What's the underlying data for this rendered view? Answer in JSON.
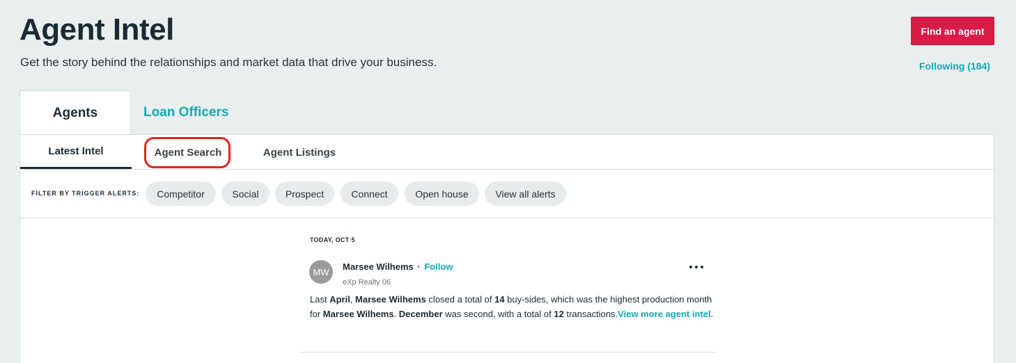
{
  "header": {
    "title": "Agent Intel",
    "subtitle": "Get the story behind the relationships and market data that drive your business.",
    "find_agent_label": "Find an agent",
    "following_label": "Following (184)"
  },
  "main_tabs": [
    {
      "label": "Agents",
      "active": true
    },
    {
      "label": "Loan Officers",
      "active": false
    }
  ],
  "sub_tabs": [
    {
      "label": "Latest Intel",
      "active": true
    },
    {
      "label": "Agent Search",
      "active": false,
      "highlighted": true
    },
    {
      "label": "Agent Listings",
      "active": false
    }
  ],
  "filters": {
    "label": "FILTER BY TRIGGER ALERTS:",
    "chips": [
      "Competitor",
      "Social",
      "Prospect",
      "Connect",
      "Open house",
      "View all alerts"
    ]
  },
  "feed": {
    "date": "TODAY, OCT 5",
    "item": {
      "avatar_initials": "MW",
      "agent_name": "Marsee Wilhems",
      "separator": "·",
      "follow_label": "Follow",
      "brokerage": "eXp Realty 06",
      "text_parts": {
        "p1": "Last ",
        "b1": "April",
        "p2": ", ",
        "b2": "Marsee Wilhems",
        "p3": " closed a total of ",
        "b3": "14",
        "p4": " buy-sides, which was the highest production month for ",
        "b4": "Marsee Wilhems",
        "p5": ". ",
        "b5": "December",
        "p6": " was second, with a total of ",
        "b6": "12",
        "p7": " transactions.",
        "link": "View more agent intel."
      }
    }
  },
  "colors": {
    "accent": "#16a9b7",
    "primary_button": "#d81b47",
    "highlight_ring": "#e5231f",
    "page_background": "#e9eeee"
  },
  "icons": {
    "more": "more-horizontal-icon"
  }
}
